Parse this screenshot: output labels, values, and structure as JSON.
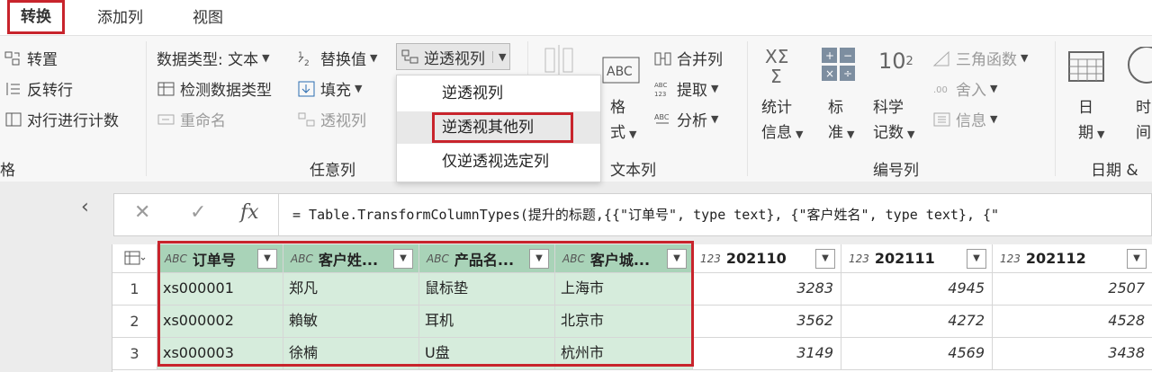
{
  "tabs": [
    "转换",
    "添加列",
    "视图"
  ],
  "ribbon": {
    "table_group": {
      "transpose": "转置",
      "reverse_rows": "反转行",
      "count_rows": "对行进行计数",
      "label": "格"
    },
    "any_column_group": {
      "data_type": "数据类型: 文本",
      "replace_values": "替换值",
      "unpivot": "逆透视列",
      "detect_type": "检测数据类型",
      "fill": "填充",
      "rename": "重命名",
      "pivot": "透视列",
      "label": "任意列"
    },
    "unpivot_menu": [
      "逆透视列",
      "逆透视其他列",
      "仅逆透视选定列"
    ],
    "text_column_group": {
      "format_line1": "格",
      "format_line2": "式",
      "merge": "合并列",
      "extract": "提取",
      "parse": "分析",
      "label": "文本列"
    },
    "number_column_group": {
      "statistics_line1": "统计",
      "statistics_line2": "信息",
      "standard_line1": "标",
      "standard_line2": "准",
      "scientific_line1": "科学",
      "scientific_line2": "记数",
      "trig": "三角函数",
      "rounding": "舍入",
      "info": "信息",
      "label": "编号列"
    },
    "datetime_group": {
      "date_line1": "日",
      "date_line2": "期",
      "time_line1": "时",
      "time_line2": "间",
      "label": "日期 &"
    }
  },
  "formula": "= Table.TransformColumnTypes(提升的标题,{{\"订单号\", type text}, {\"客户姓名\", type text}, {\"",
  "grid": {
    "columns": [
      {
        "type": "ABC",
        "name": "订单号",
        "selected": true
      },
      {
        "type": "ABC",
        "name": "客户姓...",
        "selected": true
      },
      {
        "type": "ABC",
        "name": "产品名...",
        "selected": true
      },
      {
        "type": "ABC",
        "name": "客户城...",
        "selected": true
      },
      {
        "type": "123",
        "name": "202110",
        "selected": false
      },
      {
        "type": "123",
        "name": "202111",
        "selected": false
      },
      {
        "type": "123",
        "name": "202112",
        "selected": false
      }
    ],
    "rows": [
      {
        "no": "1",
        "cells": [
          "xs000001",
          "郑凡",
          "鼠标垫",
          "上海市",
          "3283",
          "4945",
          "2507"
        ]
      },
      {
        "no": "2",
        "cells": [
          "xs000002",
          "賴敏",
          "耳机",
          "北京市",
          "3562",
          "4272",
          "4528"
        ]
      },
      {
        "no": "3",
        "cells": [
          "xs000003",
          "徐楠",
          "U盘",
          "杭州市",
          "3149",
          "4569",
          "3438"
        ]
      }
    ]
  },
  "colors": {
    "highlight_border": "#c8242c",
    "selected_header": "#a9d3b8",
    "selected_cell": "#d6ecdc"
  }
}
